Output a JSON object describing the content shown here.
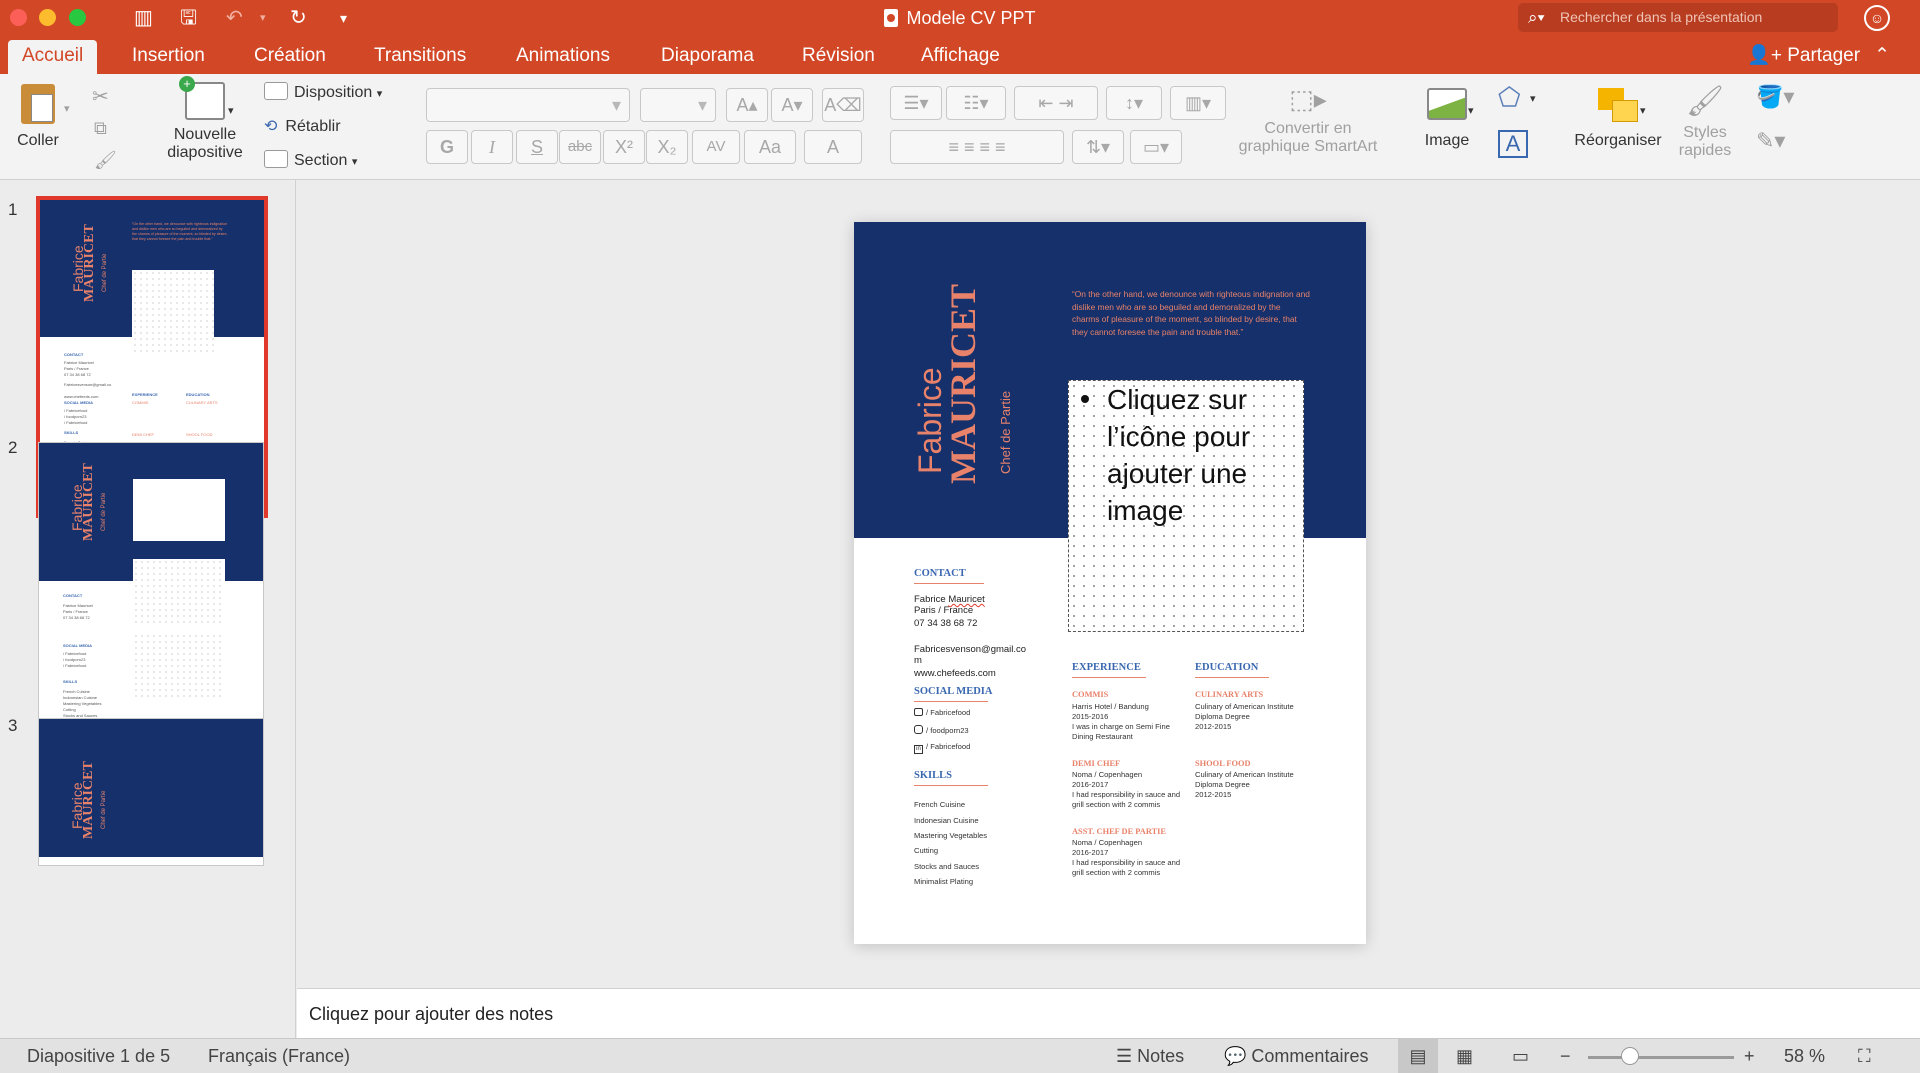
{
  "window": {
    "title": "Modele CV PPT",
    "search_placeholder": "Rechercher dans la présentation"
  },
  "colors": {
    "brand": "#d24726",
    "navy": "#15306a",
    "salmon": "#e8826a",
    "heading_blue": "#3a68b0",
    "selection": "#e0392b"
  },
  "tabs": [
    "Accueil",
    "Insertion",
    "Création",
    "Transitions",
    "Animations",
    "Diaporama",
    "Révision",
    "Affichage"
  ],
  "active_tab": "Accueil",
  "share_label": "Partager",
  "ribbon": {
    "paste": "Coller",
    "new_slide_line1": "Nouvelle",
    "new_slide_line2": "diapositive",
    "layout": "Disposition",
    "reset": "Rétablir",
    "section": "Section",
    "bold": "G",
    "italic": "I",
    "underline": "S",
    "strikethrough": "abc",
    "superscript": "X²",
    "subscript": "X₂",
    "char_spacing": "AV",
    "change_case": "Aa",
    "font_color": "A",
    "smartart_line1": "Convertir en",
    "smartart_line2": "graphique SmartArt",
    "image": "Image",
    "arrange": "Réorganiser",
    "styles_line1": "Styles",
    "styles_line2": "rapides"
  },
  "thumbnails": [
    {
      "number": "1"
    },
    {
      "number": "2"
    },
    {
      "number": "3"
    }
  ],
  "slide": {
    "first_name": "Fabrice",
    "last_name": "MAURICET",
    "role": "Chef de Partie",
    "quote": "“On the other hand, we denounce with righteous indignation and dislike men who are so beguiled and demoralized by the charms of pleasure of the moment, so blinded by desire, that they cannot foresee the pain and trouble that.”",
    "placeholder": "Cliquez sur l’icône pour ajouter une image",
    "contact_heading": "CONTACT",
    "contact_name": "Fabrice Mauricet",
    "contact_city": "Paris / France",
    "contact_phone": "07 34 38 68 72",
    "contact_email_1": "Fabricesvenson@gmail.co",
    "contact_email_2": "m",
    "contact_web": "www.chefeeds.com",
    "social_heading": "SOCIAL MEDIA",
    "social": [
      "/ Fabricefood",
      "/ foodporn23",
      "/ Fabricefood"
    ],
    "skills_heading": "SKILLS",
    "skills": [
      "French Cuisine",
      "Indonesian Cuisine",
      "Mastering Vegetables",
      "Cutting",
      "Stocks and Sauces",
      "Minimalist Plating"
    ],
    "experience_heading": "EXPERIENCE",
    "exp1_title": "COMMIS",
    "exp1_lines": [
      "Harris Hotel / Bandung",
      "2015-2016",
      "I was in charge on Semi Fine",
      "Dining Restaurant"
    ],
    "exp2_title": "DEMI CHEF",
    "exp2_lines": [
      "Noma / Copenhagen",
      "2016-2017",
      "I had responsibility in sauce and",
      "grill section with 2 commis"
    ],
    "exp3_title": "ASST. CHEF DE PARTIE",
    "exp3_lines": [
      "Noma / Copenhagen",
      "2016-2017",
      "I had responsibility in sauce and",
      "grill section with 2 commis"
    ],
    "education_heading": "EDUCATION",
    "edu1_title": "CULINARY ARTS",
    "edu1_lines": [
      "Culinary of American Institute",
      "Diploma Degree",
      "2012-2015"
    ],
    "edu2_title": "SHOOL FOOD",
    "edu2_lines": [
      "Culinary of American Institute",
      "Diploma Degree",
      "2012-2015"
    ]
  },
  "notes_placeholder": "Cliquez pour ajouter des notes",
  "status": {
    "slide_info": "Diapositive 1 de 5",
    "language": "Français (France)",
    "notes": "Notes",
    "comments": "Commentaires",
    "zoom": "58 %",
    "zoom_percent": 58
  }
}
